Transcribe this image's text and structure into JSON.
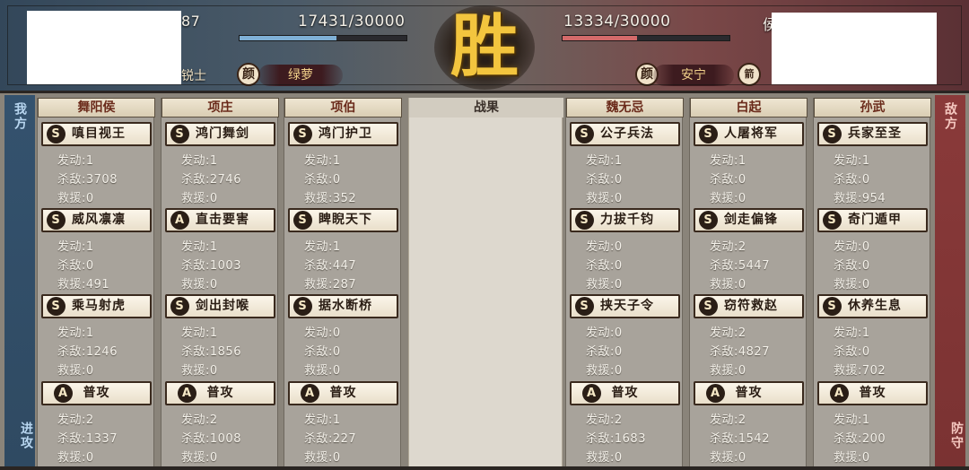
{
  "banner": {
    "left": {
      "hp_text": "17431/30000",
      "hp_fraction": 0.581,
      "partial_name": "87",
      "tag": "锐士",
      "icon_label": "颜",
      "pill": "绿萝"
    },
    "right": {
      "hp_text": "13334/30000",
      "hp_fraction": 0.444,
      "partial_name": "侯",
      "icon_label": "颜",
      "pill": "安宁",
      "icon2_label": "箭"
    },
    "result": "胜"
  },
  "sides": {
    "left_top": "我方",
    "left_bottom": "进攻",
    "right_top": "敌方",
    "right_bottom": "防守"
  },
  "result_header": "战果",
  "labels": {
    "trigger": "发动:",
    "kills": "杀敌:",
    "rescue": "救援:"
  },
  "columns": [
    {
      "name": "舞阳侯",
      "skills": [
        {
          "badge": "S",
          "name": "嗔目视王",
          "trigger": "1",
          "kills": "3708",
          "rescue": "0"
        },
        {
          "badge": "S",
          "name": "威风凛凛",
          "trigger": "1",
          "kills": "0",
          "rescue": "491"
        },
        {
          "badge": "S",
          "name": "乘马射虎",
          "trigger": "1",
          "kills": "1246",
          "rescue": "0"
        },
        {
          "badge": "A",
          "name": "普攻",
          "trigger": "2",
          "kills": "1337",
          "rescue": "0"
        }
      ]
    },
    {
      "name": "项庄",
      "skills": [
        {
          "badge": "S",
          "name": "鸿门舞剑",
          "trigger": "1",
          "kills": "2746",
          "rescue": "0"
        },
        {
          "badge": "A",
          "name": "直击要害",
          "trigger": "1",
          "kills": "1003",
          "rescue": "0"
        },
        {
          "badge": "S",
          "name": "剑出封喉",
          "trigger": "1",
          "kills": "1856",
          "rescue": "0"
        },
        {
          "badge": "A",
          "name": "普攻",
          "trigger": "2",
          "kills": "1008",
          "rescue": "0"
        }
      ]
    },
    {
      "name": "项伯",
      "skills": [
        {
          "badge": "S",
          "name": "鸿门护卫",
          "trigger": "1",
          "kills": "0",
          "rescue": "352"
        },
        {
          "badge": "S",
          "name": "睥睨天下",
          "trigger": "1",
          "kills": "447",
          "rescue": "287"
        },
        {
          "badge": "S",
          "name": "据水断桥",
          "trigger": "0",
          "kills": "0",
          "rescue": "0"
        },
        {
          "badge": "A",
          "name": "普攻",
          "trigger": "1",
          "kills": "227",
          "rescue": "0"
        }
      ]
    },
    {
      "name": "魏无忌",
      "skills": [
        {
          "badge": "S",
          "name": "公子兵法",
          "trigger": "1",
          "kills": "0",
          "rescue": "0"
        },
        {
          "badge": "S",
          "name": "力拔千钧",
          "trigger": "0",
          "kills": "0",
          "rescue": "0"
        },
        {
          "badge": "S",
          "name": "挟天子令",
          "trigger": "0",
          "kills": "0",
          "rescue": "0"
        },
        {
          "badge": "A",
          "name": "普攻",
          "trigger": "2",
          "kills": "1683",
          "rescue": "0"
        }
      ]
    },
    {
      "name": "白起",
      "skills": [
        {
          "badge": "S",
          "name": "人屠将军",
          "trigger": "1",
          "kills": "0",
          "rescue": "0"
        },
        {
          "badge": "S",
          "name": "剑走偏锋",
          "trigger": "2",
          "kills": "5447",
          "rescue": "0"
        },
        {
          "badge": "S",
          "name": "窃符救赵",
          "trigger": "2",
          "kills": "4827",
          "rescue": "0"
        },
        {
          "badge": "A",
          "name": "普攻",
          "trigger": "2",
          "kills": "1542",
          "rescue": "0"
        }
      ]
    },
    {
      "name": "孙武",
      "skills": [
        {
          "badge": "S",
          "name": "兵家至圣",
          "trigger": "1",
          "kills": "0",
          "rescue": "954"
        },
        {
          "badge": "S",
          "name": "奇门遁甲",
          "trigger": "0",
          "kills": "0",
          "rescue": "0"
        },
        {
          "badge": "S",
          "name": "休养生息",
          "trigger": "1",
          "kills": "0",
          "rescue": "702"
        },
        {
          "badge": "A",
          "name": "普攻",
          "trigger": "1",
          "kills": "200",
          "rescue": "0"
        }
      ]
    }
  ],
  "colors": {
    "ally_strip": "#34526e",
    "enemy_strip": "#8a3a3a",
    "hp_ally": "#7fb0d6",
    "hp_enemy": "#d46a6a",
    "victory": "#f3c53e"
  }
}
